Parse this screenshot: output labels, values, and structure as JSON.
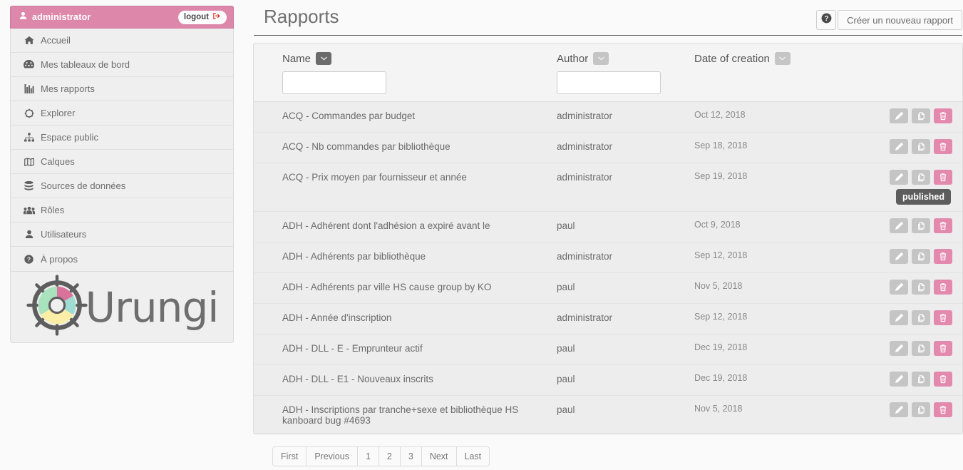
{
  "sidebar": {
    "user": {
      "name": "administrator",
      "icon": "user-icon"
    },
    "logout_label": "logout",
    "items": [
      {
        "label": "Accueil",
        "icon": "home-icon"
      },
      {
        "label": "Mes tableaux de bord",
        "icon": "dashboard-icon"
      },
      {
        "label": "Mes rapports",
        "icon": "bar-chart-icon"
      },
      {
        "label": "Explorer",
        "icon": "compass-icon"
      },
      {
        "label": "Espace public",
        "icon": "sitemap-icon"
      },
      {
        "label": "Calques",
        "icon": "map-icon"
      },
      {
        "label": "Sources de données",
        "icon": "database-icon"
      },
      {
        "label": "Rôles",
        "icon": "users-icon"
      },
      {
        "label": "Utilisateurs",
        "icon": "user-icon"
      },
      {
        "label": "À propos",
        "icon": "question-circle-icon"
      }
    ],
    "logo": {
      "text": "Urungi",
      "icon": "ship-wheel-donut-logo"
    }
  },
  "header": {
    "title": "Rapports",
    "help_icon": "question-circle-icon",
    "create_label": "Créer un nouveau rapport"
  },
  "table": {
    "columns": [
      {
        "label": "Name",
        "sort_icon": "chevron-down-icon",
        "sort_active": true,
        "has_filter": true
      },
      {
        "label": "Author",
        "sort_icon": "chevron-down-icon",
        "sort_active": false,
        "has_filter": true
      },
      {
        "label": "Date of creation",
        "sort_icon": "chevron-down-icon",
        "sort_active": false,
        "has_filter": false
      }
    ],
    "filters": {
      "name_value": "",
      "author_value": ""
    },
    "row_actions": [
      {
        "name": "edit",
        "icon": "pencil-icon",
        "style": "grey"
      },
      {
        "name": "duplicate",
        "icon": "copy-icon",
        "style": "grey"
      },
      {
        "name": "delete",
        "icon": "trash-icon",
        "style": "pink"
      }
    ],
    "tooltip": {
      "text": "published",
      "row_index": 2
    },
    "rows": [
      {
        "name": "ACQ - Commandes par budget",
        "author": "administrator",
        "date": "Oct 12, 2018"
      },
      {
        "name": "ACQ - Nb commandes par bibliothèque",
        "author": "administrator",
        "date": "Sep 18, 2018"
      },
      {
        "name": "ACQ - Prix moyen par fournisseur et année",
        "author": "administrator",
        "date": "Sep 19, 2018"
      },
      {
        "name": "ADH - Adhérent dont l'adhésion a expiré avant le",
        "author": "paul",
        "date": "Oct 9, 2018"
      },
      {
        "name": "ADH - Adhérents par bibliothèque",
        "author": "administrator",
        "date": "Sep 12, 2018"
      },
      {
        "name": "ADH - Adhérents par ville HS cause group by KO",
        "author": "paul",
        "date": "Nov 5, 2018"
      },
      {
        "name": "ADH - Année d'inscription",
        "author": "administrator",
        "date": "Sep 12, 2018"
      },
      {
        "name": "ADH - DLL - E - Emprunteur actif",
        "author": "paul",
        "date": "Dec 19, 2018"
      },
      {
        "name": "ADH - DLL - E1 - Nouveaux inscrits",
        "author": "paul",
        "date": "Dec 19, 2018"
      },
      {
        "name": "ADH - Inscriptions par tranche+sexe et bibliothèque HS kanboard bug #4693",
        "author": "paul",
        "date": "Nov 5, 2018"
      }
    ]
  },
  "pagination": {
    "first": "First",
    "previous": "Previous",
    "pages": [
      "1",
      "2",
      "3"
    ],
    "next": "Next",
    "last": "Last"
  },
  "colors": {
    "brand_pink": "#dd88aa",
    "delete_pink": "#e489ae",
    "action_grey": "#c5c5c5",
    "sort_active": "#6b6b6b",
    "tooltip_bg": "#5d5d5d"
  }
}
